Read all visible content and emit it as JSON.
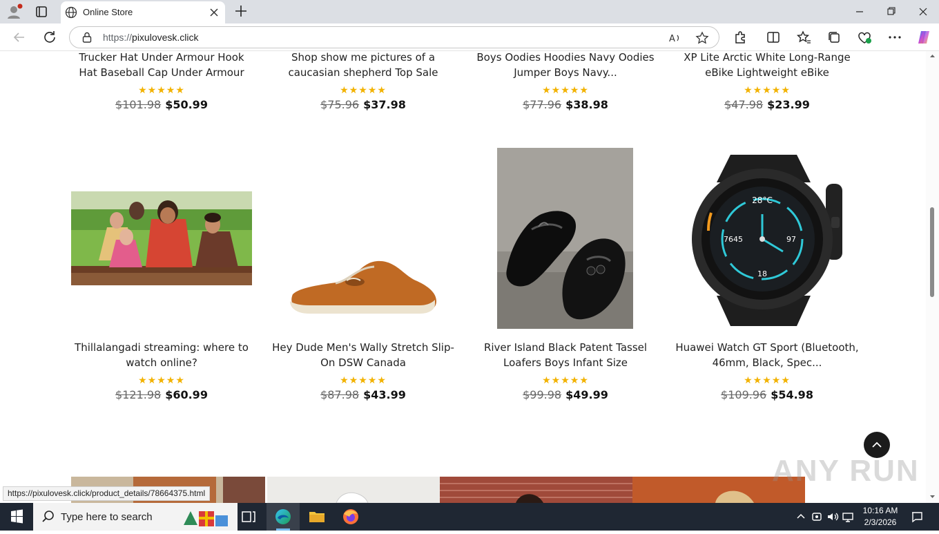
{
  "browser": {
    "tab_title": "Online Store",
    "url_protocol": "https://",
    "url_host": "pixulovesk.click",
    "status_url": "https://pixulovesk.click/product_details/78664375.html"
  },
  "products_top": [
    {
      "name": "Trucker Hat Under Armour Hook Hat Baseball Cap Under Armour",
      "stars": "★★★★★",
      "old_price": "$101.98",
      "price": "$50.99"
    },
    {
      "name": "Shop show me pictures of a caucasian shepherd Top Sale",
      "stars": "★★★★★",
      "old_price": "$75.96",
      "price": "$37.98"
    },
    {
      "name": "Boys Oodies Hoodies Navy Oodies Jumper Boys Navy...",
      "stars": "★★★★★",
      "old_price": "$77.96",
      "price": "$38.98"
    },
    {
      "name": "XP Lite Arctic White Long-Range eBike Lightweight eBike",
      "stars": "★★★★★",
      "old_price": "$47.98",
      "price": "$23.99"
    }
  ],
  "products": [
    {
      "name": "Thillalangadi streaming: where to watch online?",
      "stars": "★★★★★",
      "old_price": "$121.98",
      "price": "$60.99"
    },
    {
      "name": "Hey Dude Men's Wally Stretch Slip-On DSW Canada",
      "stars": "★★★★★",
      "old_price": "$87.98",
      "price": "$43.99"
    },
    {
      "name": "River Island Black Patent Tassel Loafers Boys Infant Size",
      "stars": "★★★★★",
      "old_price": "$99.98",
      "price": "$49.99"
    },
    {
      "name": "Huawei Watch GT Sport (Bluetooth, 46mm, Black, Spec...",
      "stars": "★★★★★",
      "old_price": "$109.96",
      "price": "$54.98"
    }
  ],
  "watch_face": {
    "temp": "28°C",
    "left": "7645",
    "right": "97",
    "date": "18"
  },
  "watermark": "ANY RUN",
  "taskbar": {
    "search_placeholder": "Type here to search",
    "time": "10:16 AM",
    "date": "2/3/2026"
  },
  "icons": [
    "profile-icon",
    "tab-actions-icon",
    "globe-icon",
    "close-icon",
    "new-tab-icon",
    "minimize-icon",
    "restore-icon",
    "window-close-icon",
    "back-icon",
    "refresh-icon",
    "lock-icon",
    "read-aloud-icon",
    "favorite-star-icon",
    "extensions-icon",
    "split-screen-icon",
    "favorites-icon",
    "collections-icon",
    "browser-essentials-icon",
    "more-icon",
    "copilot-icon",
    "windows-start-icon",
    "search-icon",
    "task-view-icon",
    "edge-icon",
    "file-explorer-icon",
    "firefox-icon",
    "chevron-up-icon",
    "network-icon",
    "volume-icon",
    "notification-icon"
  ],
  "colors": {
    "star": "#f2b200",
    "taskbar": "#1f2733",
    "accent": "#76b9ed"
  }
}
